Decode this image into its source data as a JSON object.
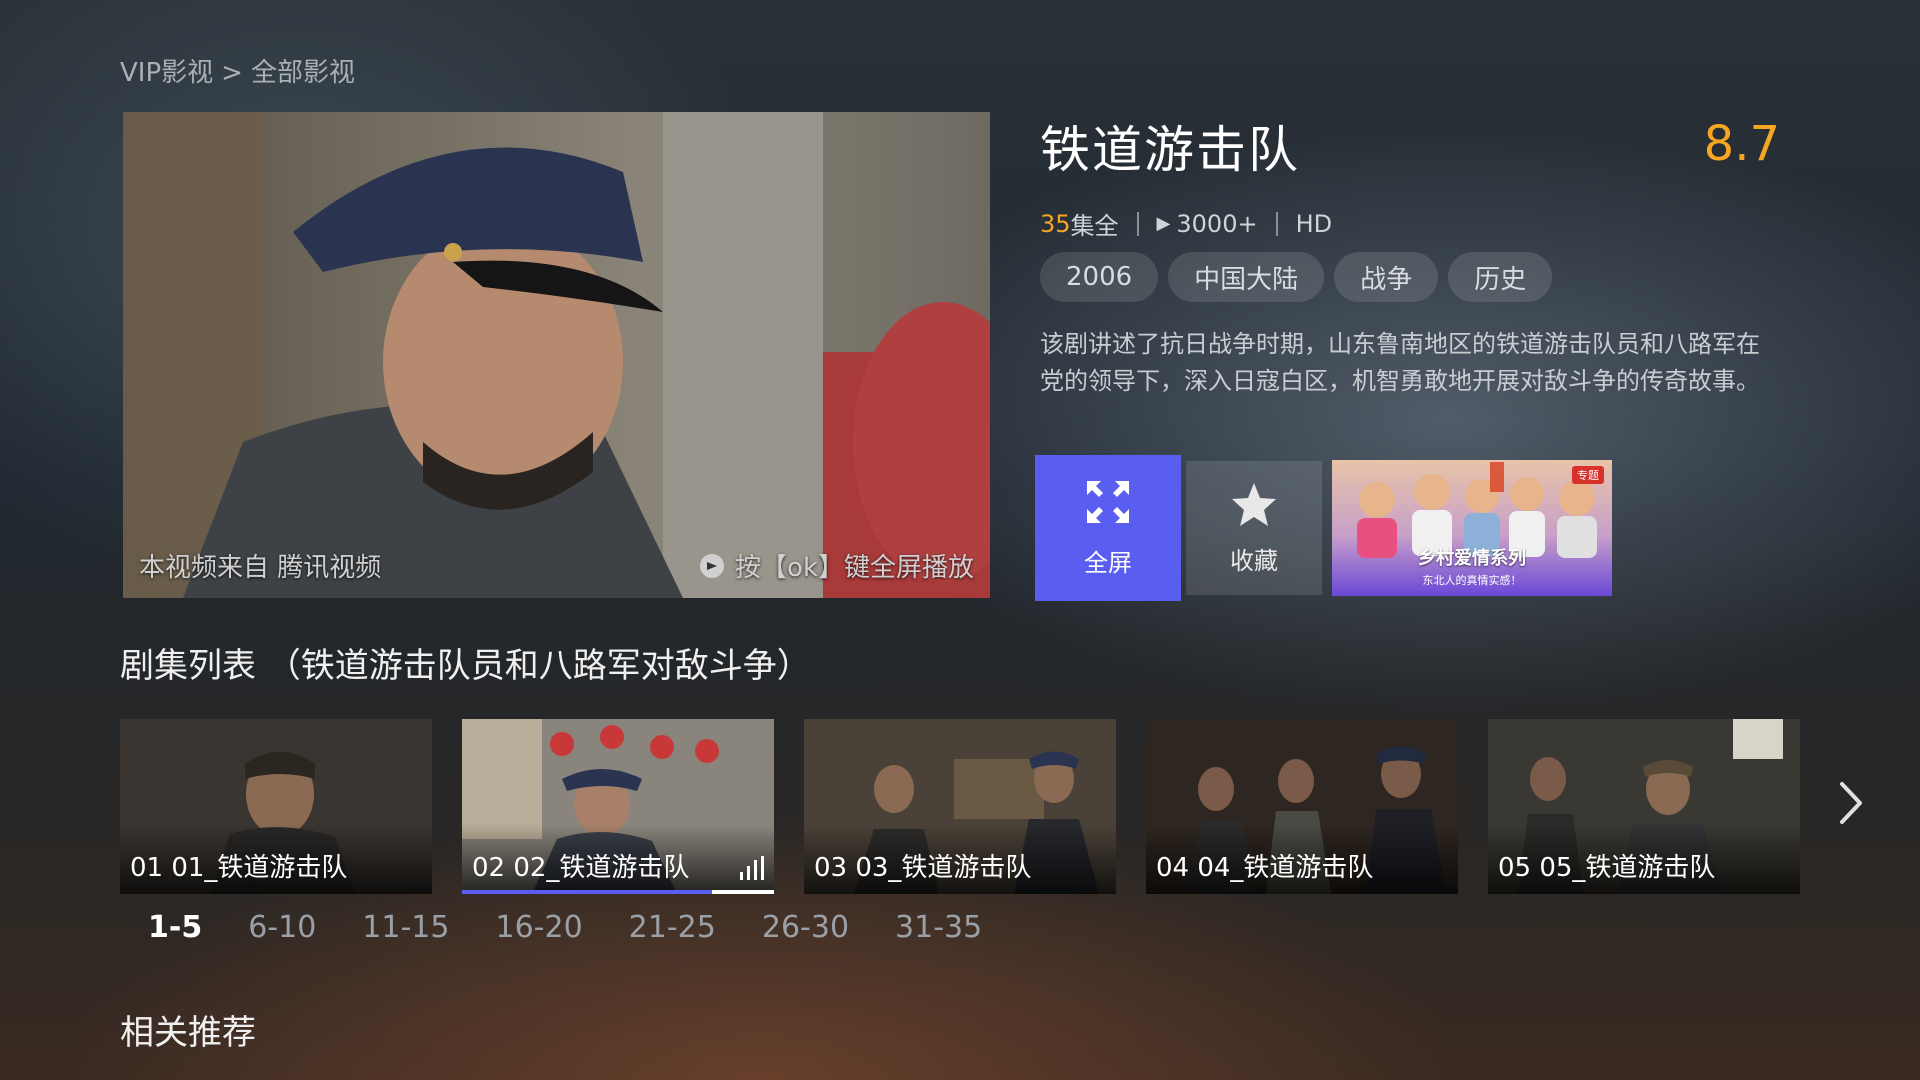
{
  "breadcrumb": {
    "root": "VIP影视",
    "separator": ">",
    "current": "全部影视"
  },
  "preview": {
    "source_text": "本视频来自 腾讯视频",
    "hint_text": "按【ok】键全屏播放"
  },
  "show": {
    "title": "铁道游击队",
    "rating": "8.7",
    "episodes_count": "35",
    "episodes_suffix": "集全",
    "plays": "3000+",
    "quality": "HD",
    "tags": [
      "2006",
      "中国大陆",
      "战争",
      "历史"
    ],
    "description": "该剧讲述了抗日战争时期，山东鲁南地区的铁道游击队员和八路军在党的领导下，深入日寇白区，机智勇敢地开展对敌斗争的传奇故事。"
  },
  "actions": {
    "fullscreen_label": "全屏",
    "favorite_label": "收藏"
  },
  "promo": {
    "badge": "专题",
    "title": "乡村爱情系列",
    "subtitle": "东北人的真情实感！"
  },
  "episode_section": {
    "title": "剧集列表 （铁道游击队员和八路军对敌斗争）",
    "episodes": [
      {
        "label": "01 01_铁道游击队",
        "playing": false
      },
      {
        "label": "02 02_铁道游击队",
        "playing": true,
        "progress": 0.8
      },
      {
        "label": "03 03_铁道游击队",
        "playing": false
      },
      {
        "label": "04 04_铁道游击队",
        "playing": false
      },
      {
        "label": "05 05_铁道游击队",
        "playing": false
      }
    ],
    "ranges": [
      "1-5",
      "6-10",
      "11-15",
      "16-20",
      "21-25",
      "26-30",
      "31-35"
    ],
    "active_range": "1-5"
  },
  "related": {
    "title": "相关推荐"
  },
  "colors": {
    "accent": "#5a5ef0",
    "rating": "#f5a623"
  },
  "icons": [
    "fullscreen-icon",
    "star-icon",
    "play-triangle-icon",
    "playing-bars-icon",
    "chevron-right-icon",
    "source-logo-icon"
  ]
}
